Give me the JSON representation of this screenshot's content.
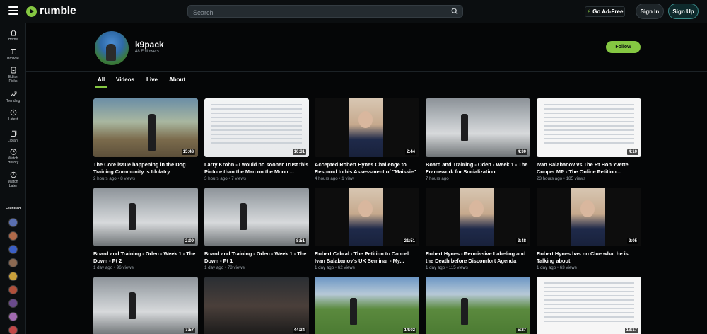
{
  "app": {
    "brand": "rumble",
    "search_placeholder": "Search",
    "ad_free_label": "Go Ad-Free",
    "sign_in_label": "Sign In",
    "sign_up_label": "Sign Up",
    "brand_color": "#85c742"
  },
  "sidebar": {
    "items": [
      {
        "label": "Home",
        "icon": "home-icon"
      },
      {
        "label": "Browse",
        "icon": "browse-icon"
      },
      {
        "label": "Editor Picks",
        "icon": "editor-picks-icon"
      },
      {
        "label": "Trending",
        "icon": "trending-icon"
      },
      {
        "label": "Latest",
        "icon": "clock-icon"
      },
      {
        "label": "Library",
        "icon": "library-icon"
      },
      {
        "label": "Watch History",
        "icon": "history-icon"
      },
      {
        "label": "Watch Later",
        "icon": "watch-later-icon"
      }
    ],
    "featured_label": "Featured",
    "featured_colors": [
      "#5a6fb0",
      "#b06a4a",
      "#3b5fc4",
      "#8c6a52",
      "#c9a03b",
      "#b0503b",
      "#6a4a8c",
      "#a06ab0",
      "#c24848"
    ]
  },
  "channel": {
    "name": "k9pack",
    "followers": "48 Followers",
    "follow_label": "Follow"
  },
  "tabs": [
    "All",
    "Videos",
    "Live",
    "About"
  ],
  "active_tab": "All",
  "videos": [
    {
      "title": "The Core issue happening in the Dog Training Community is Idolatry",
      "meta": "2 hours ago • 8 views",
      "duration": "15:48",
      "thumb": "outdoor"
    },
    {
      "title": "Larry Krohn - I would no sooner Trust this Picture than the Man on the Moon ...",
      "meta": "3 hours ago • 7 views",
      "duration": "10:31",
      "thumb": "screen"
    },
    {
      "title": "Accepted Robert Hynes Challenge to Respond to his Assessment of \"Maissie\"",
      "meta": "4 hours ago • 1 view",
      "duration": "2:44",
      "thumb": "portrait"
    },
    {
      "title": "Board and Training - Oden - Week 1 - The Framework for Socialization",
      "meta": "7 hours ago",
      "duration": "4:30",
      "thumb": "garage"
    },
    {
      "title": "Ivan Balabanov vs The Rt Hon Yvette Cooper MP - The Online Petition...",
      "meta": "23 hours ago • 185 views",
      "duration": "4:10",
      "thumb": "doc"
    },
    {
      "title": "Board and Training - Oden - Week 1 - The Down - Pt 2",
      "meta": "1 day ago • 96 views",
      "duration": "2:09",
      "thumb": "garage"
    },
    {
      "title": "Board and Training - Oden - Week 1 - The Down - Pt 1",
      "meta": "1 day ago • 78 views",
      "duration": "8:51",
      "thumb": "garage"
    },
    {
      "title": "Robert Cabral - The Petition to Cancel Ivan Balabanov's UK Seminar - My...",
      "meta": "1 day ago • 62 views",
      "duration": "21:51",
      "thumb": "portrait"
    },
    {
      "title": "Robert Hynes - Permissive Labeling and the Death before Discomfort Agenda",
      "meta": "1 day ago • 115 views",
      "duration": "3:48",
      "thumb": "portrait"
    },
    {
      "title": "Robert Hynes has no Clue what he is Talking about",
      "meta": "1 day ago • 63 views",
      "duration": "2:05",
      "thumb": "portrait"
    },
    {
      "title": "",
      "meta": "",
      "duration": "7:57",
      "thumb": "garage"
    },
    {
      "title": "",
      "meta": "",
      "duration": "44:34",
      "thumb": "dark"
    },
    {
      "title": "",
      "meta": "",
      "duration": "14:02",
      "thumb": "grass"
    },
    {
      "title": "",
      "meta": "",
      "duration": "5:27",
      "thumb": "grass"
    },
    {
      "title": "",
      "meta": "",
      "duration": "18:17",
      "thumb": "doc"
    }
  ]
}
